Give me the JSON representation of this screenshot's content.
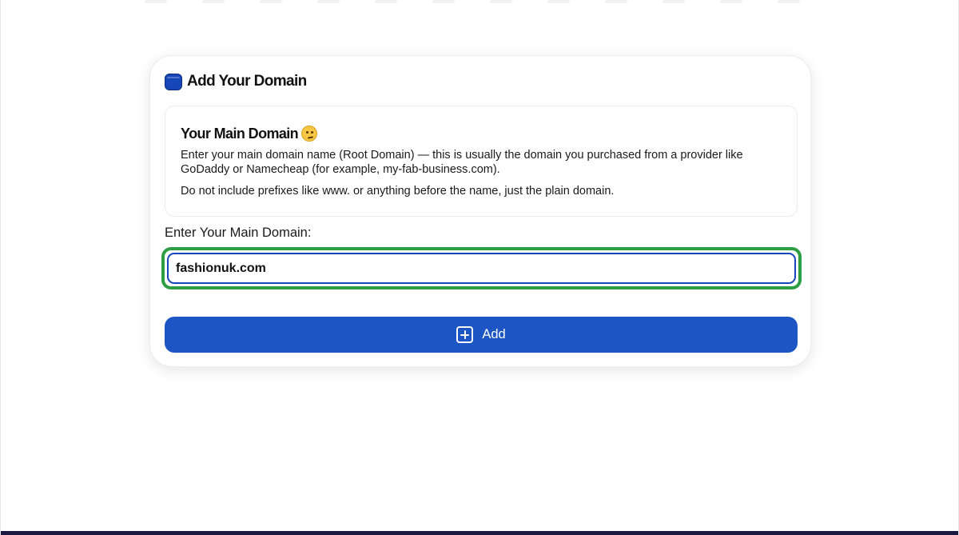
{
  "card": {
    "title": "Add Your Domain",
    "icon": "database-icon",
    "info": {
      "title": "Your Main Domain",
      "title_emoji": "thinking-face-icon",
      "paragraph_1": "Enter your main domain name (Root Domain) — this is usually the domain you purchased from a provider like GoDaddy or Namecheap (for example, my-fab-business.com).",
      "paragraph_2": "Do not include prefixes like www. or anything before the name, just the plain domain."
    },
    "field": {
      "label": "Enter Your Main Domain:",
      "value": "fashionuk.com"
    },
    "add_button": {
      "label": "Add",
      "icon": "plus-square-icon"
    }
  },
  "colors": {
    "accent": "#1d55c4",
    "focus_highlight": "#2e9e44",
    "input_border": "#1746b8",
    "bottom_bar": "#1c1840"
  }
}
